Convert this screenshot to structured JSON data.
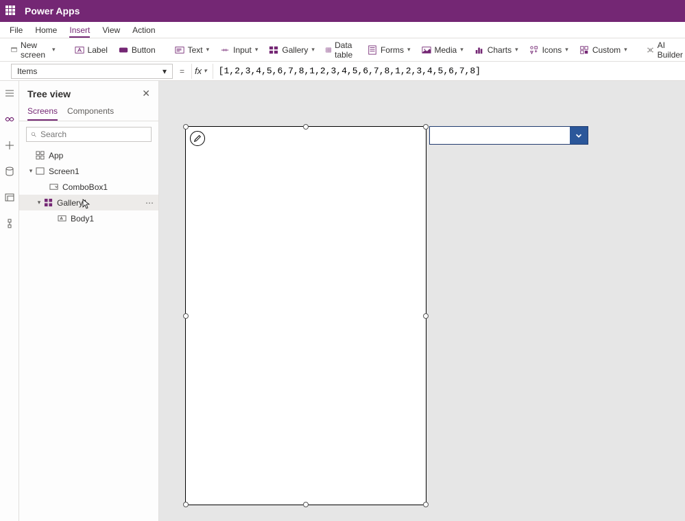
{
  "header": {
    "title": "Power Apps"
  },
  "menu": {
    "items": [
      "File",
      "Home",
      "Insert",
      "View",
      "Action"
    ],
    "active": "Insert"
  },
  "ribbon": {
    "new_screen": "New screen",
    "label": "Label",
    "button": "Button",
    "text": "Text",
    "input": "Input",
    "gallery": "Gallery",
    "data_table": "Data table",
    "forms": "Forms",
    "media": "Media",
    "charts": "Charts",
    "icons": "Icons",
    "custom": "Custom",
    "ai_builder": "AI Builder"
  },
  "formula": {
    "property": "Items",
    "value": "[1,2,3,4,5,6,7,8,1,2,3,4,5,6,7,8,1,2,3,4,5,6,7,8]"
  },
  "tree": {
    "title": "Tree view",
    "tabs": {
      "screens": "Screens",
      "components": "Components"
    },
    "search_placeholder": "Search",
    "app": "App",
    "screen1": "Screen1",
    "combobox1": "ComboBox1",
    "gallery1": "Gallery1",
    "body1": "Body1"
  }
}
